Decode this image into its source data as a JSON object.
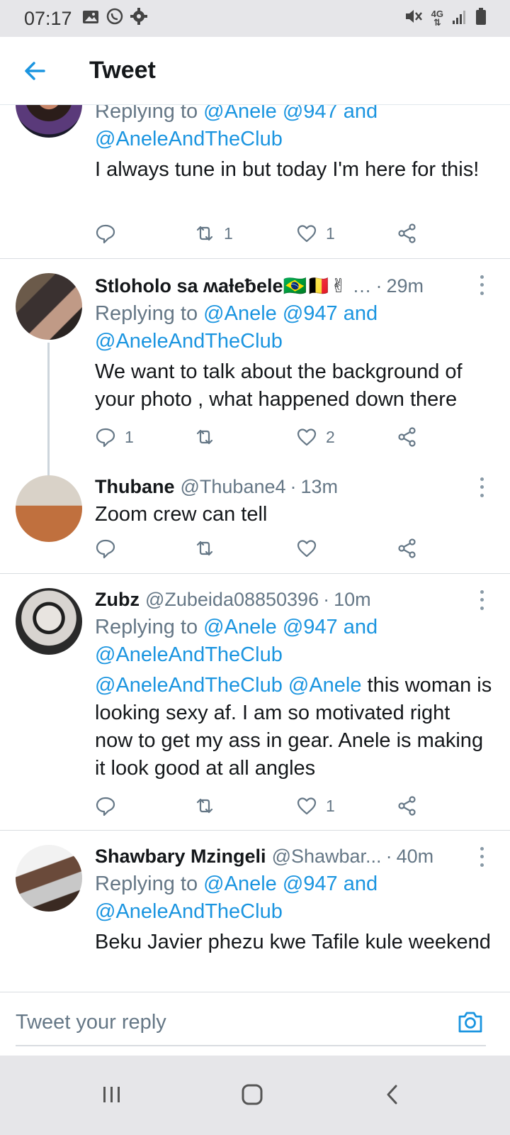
{
  "status_bar": {
    "time": "07:17",
    "network": "4G",
    "left_icons": [
      "image-icon",
      "whatsapp-icon",
      "settings-gear-icon"
    ],
    "right_icons": [
      "mute-icon",
      "network-4g-icon",
      "signal-icon",
      "battery-icon"
    ]
  },
  "header": {
    "title": "Tweet",
    "back_icon": "back-arrow-icon"
  },
  "colors": {
    "accent": "#1b95e0",
    "text": "#14171a",
    "muted": "#657786",
    "divider": "#d9dde1"
  },
  "tweets": [
    {
      "reply_prefix": "Replying to",
      "reply_links": "@Anele @947 and",
      "reply_links2": "@AneleAndTheClub",
      "text": "I always tune in but today I'm here for this!",
      "reply_count": "",
      "retweet_count": "1",
      "like_count": "1"
    },
    {
      "name": "Stloholo sa ʍaƚeƀele🇧🇷🇧🇪✌",
      "handle_ellipsis": "…",
      "dot": "·",
      "time": "29m",
      "reply_prefix": "Replying to",
      "reply_links": "@Anele @947 and",
      "reply_links2": "@AneleAndTheClub",
      "text": "We want to talk about the background of your photo , what happened down there",
      "reply_count": "1",
      "retweet_count": "",
      "like_count": "2"
    },
    {
      "name": "Thubane",
      "handle": "@Thubane4",
      "dot": "·",
      "time": "13m",
      "text": "Zoom  crew can tell",
      "reply_count": "",
      "retweet_count": "",
      "like_count": ""
    },
    {
      "name": "Zubz",
      "handle": "@Zubeida08850396",
      "dot": "·",
      "time": "10m",
      "reply_prefix": "Replying to",
      "reply_links": "@Anele @947 and",
      "reply_links2": "@AneleAndTheClub",
      "text_mention": "@AneleAndTheClub @Anele",
      "text": " this woman is looking sexy af. I am so motivated right now to get my ass in gear. Anele is making it look good at all angles",
      "reply_count": "",
      "retweet_count": "",
      "like_count": "1"
    },
    {
      "name": "Shawbary Mzingeli",
      "handle": "@Shawbar...",
      "dot": "·",
      "time": "40m",
      "reply_prefix": "Replying to",
      "reply_links": "@Anele @947 and",
      "reply_links2": "@AneleAndTheClub",
      "text": "Beku Javier phezu kwe Tafile kule weekend"
    }
  ],
  "reply_box": {
    "placeholder": "Tweet your reply",
    "camera_icon": "camera-icon"
  },
  "nav_bar": {
    "icons": [
      "recent-apps-icon",
      "home-icon",
      "back-icon"
    ]
  }
}
